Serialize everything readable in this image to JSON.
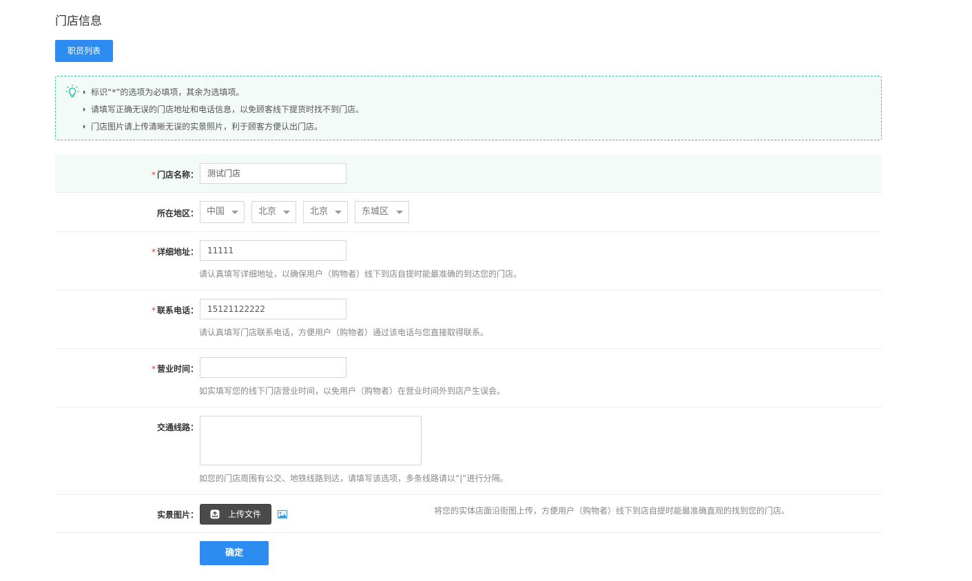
{
  "header": {
    "title": "门店信息",
    "staff_button": "职员列表"
  },
  "tips": {
    "icon": "lightbulb-icon",
    "lines": [
      "标识“*”的选项为必填项，其余为选填项。",
      "请填写正确无误的门店地址和电话信息，以免顾客线下提货时找不到门店。",
      "门店图片请上传清晰无误的实景照片，利于顾客方便认出门店。"
    ]
  },
  "form": {
    "store_name": {
      "required": "*",
      "label": "门店名称：",
      "value": "测试门店"
    },
    "region": {
      "label": "所在地区：",
      "country": "中国",
      "province": "北京",
      "city": "北京",
      "district": "东城区"
    },
    "address": {
      "required": "*",
      "label": "详细地址：",
      "value": "11111",
      "hint": "请认真填写详细地址，以确保用户（购物者）线下到店自提时能最准确的到达您的门店。"
    },
    "phone": {
      "required": "*",
      "label": "联系电话：",
      "value": "15121122222",
      "hint": "请认真填写门店联系电话，方便用户（购物者）通过该电话与您直接取得联系。"
    },
    "hours": {
      "required": "*",
      "label": "营业时间：",
      "value": "",
      "hint": "如实填写您的线下门店营业时间，以免用户（购物者）在营业时间外到店产生误会。"
    },
    "transit": {
      "label": "交通线路：",
      "value": "",
      "hint": "如您的门店周围有公交、地铁线路到达，请填写该选项，多条线路请以“|”进行分隔。"
    },
    "photo": {
      "label": "实景图片：",
      "upload_label": "上传文件",
      "hint": "将您的实体店面沿街图上传，方便用户（购物者）线下到店自提时能最准确直观的找到您的门店。"
    },
    "submit": "确定"
  },
  "colors": {
    "primary": "#2d8cf0",
    "tip_border": "#3cc3a0",
    "tip_bg": "#f3fbf9",
    "required": "#e4393c"
  }
}
